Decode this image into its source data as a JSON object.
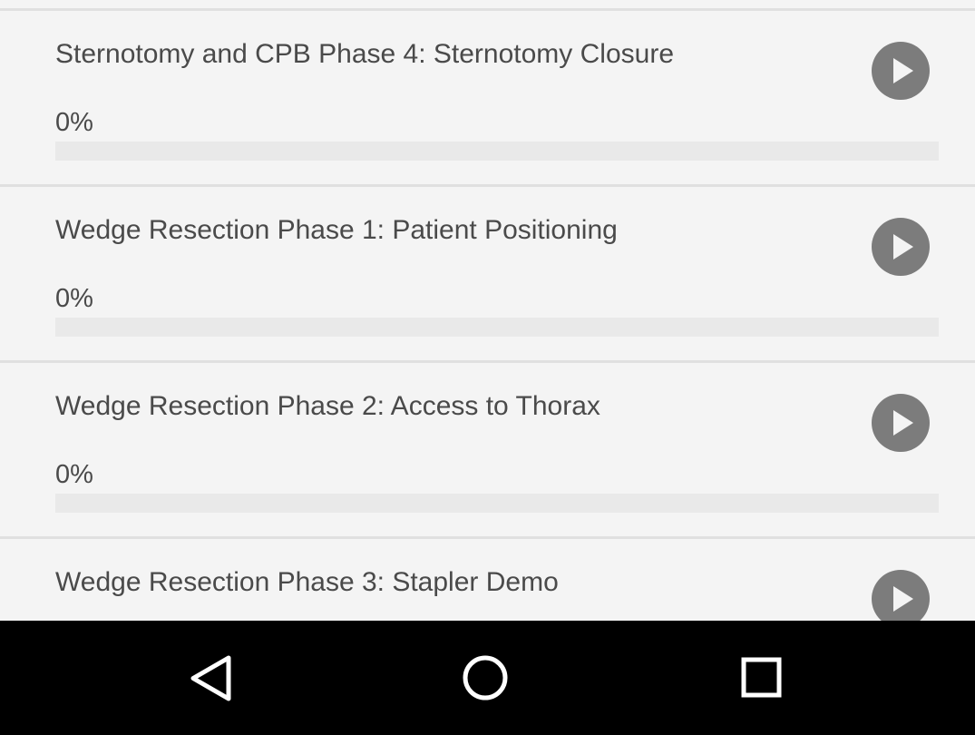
{
  "items": [
    {
      "title": "Sternotomy and CPB Phase 4: Sternotomy Closure",
      "percent_label": "0%",
      "progress": 0
    },
    {
      "title": "Wedge Resection Phase 1: Patient Positioning",
      "percent_label": "0%",
      "progress": 0
    },
    {
      "title": "Wedge Resection Phase 2: Access to Thorax",
      "percent_label": "0%",
      "progress": 0
    },
    {
      "title": "Wedge Resection Phase 3: Stapler Demo",
      "percent_label": "",
      "progress": 0
    }
  ],
  "icons": {
    "play": "play-icon",
    "back": "back-triangle-icon",
    "home": "home-circle-icon",
    "recents": "recents-square-icon"
  },
  "colors": {
    "background": "#f4f4f4",
    "text": "#4a4a4a",
    "play_button": "#7c7c7c",
    "navbar": "#000000"
  }
}
